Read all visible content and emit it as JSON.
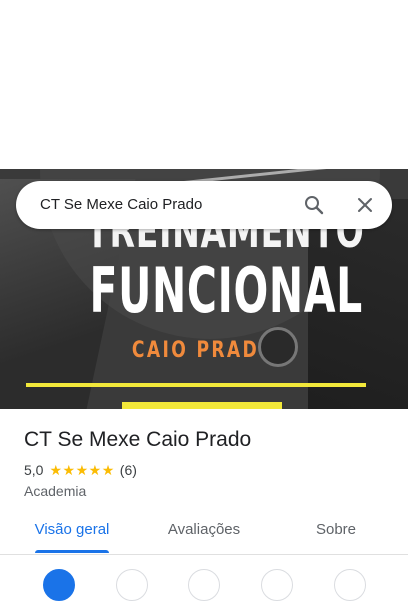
{
  "search": {
    "query": "CT Se Mexe Caio Prado"
  },
  "hero": {
    "line1": "TREINAMENTO",
    "line2": "FUNCIONAL",
    "line3": "CAIO PRADO"
  },
  "place": {
    "name": "CT Se Mexe Caio Prado",
    "rating": "5,0",
    "stars": 5,
    "reviews": "(6)",
    "category": "Academia"
  },
  "tabs": [
    {
      "label": "Visão geral",
      "selected": true
    },
    {
      "label": "Avaliações",
      "selected": false
    },
    {
      "label": "Sobre",
      "selected": false
    }
  ],
  "colors": {
    "accent": "#1a73e8",
    "star": "#fbbc04",
    "hero_orange": "#f08a3c",
    "hero_yellow": "#f2e83a"
  },
  "icons": [
    "search-icon",
    "close-icon",
    "star-icon"
  ]
}
